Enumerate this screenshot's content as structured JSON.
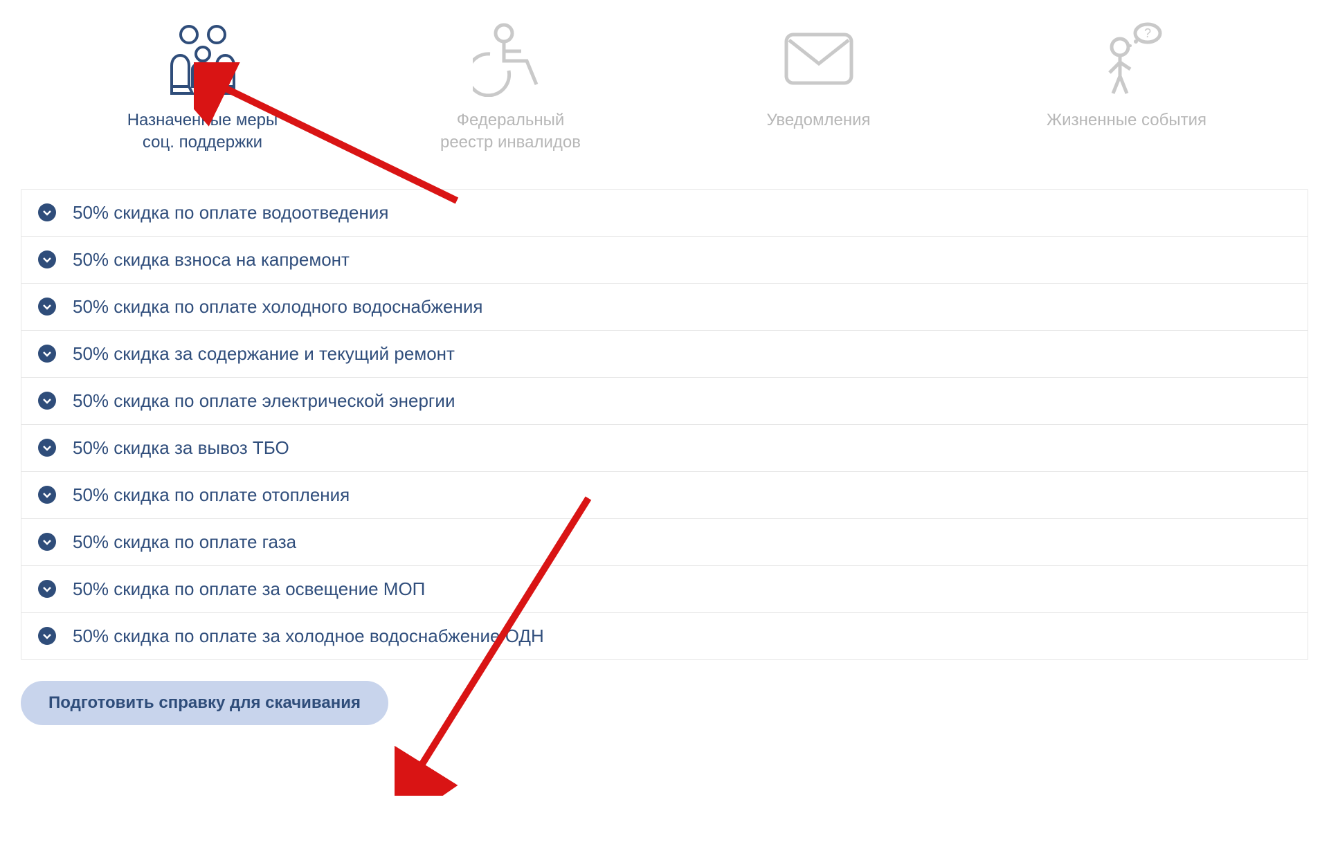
{
  "tabs": [
    {
      "label_line1": "Назначенные меры",
      "label_line2": "соц. поддержки",
      "active": true
    },
    {
      "label_line1": "Федеральный",
      "label_line2": "реестр инвалидов",
      "active": false
    },
    {
      "label_line1": "Уведомления",
      "label_line2": "",
      "active": false
    },
    {
      "label_line1": "Жизненные события",
      "label_line2": "",
      "active": false
    }
  ],
  "discounts": [
    {
      "label": "50% скидка по оплате водоотведения"
    },
    {
      "label": "50% скидка взноса на капремонт"
    },
    {
      "label": "50% скидка по оплате холодного водоснабжения"
    },
    {
      "label": "50% скидка за содержание и текущий ремонт"
    },
    {
      "label": "50% скидка по оплате электрической энергии"
    },
    {
      "label": "50% скидка за вывоз ТБО"
    },
    {
      "label": "50% скидка по оплате отопления"
    },
    {
      "label": "50% скидка по оплате газа"
    },
    {
      "label": "50% скидка по оплате за освещение МОП"
    },
    {
      "label": "50% скидка по оплате за холодное водоснабжение ОДН"
    }
  ],
  "download_button": "Подготовить справку для скачивания",
  "colors": {
    "primary": "#2f4d7a",
    "inactive": "#b7b7b7",
    "button_bg": "#c8d4ec",
    "arrow": "#d91414"
  }
}
